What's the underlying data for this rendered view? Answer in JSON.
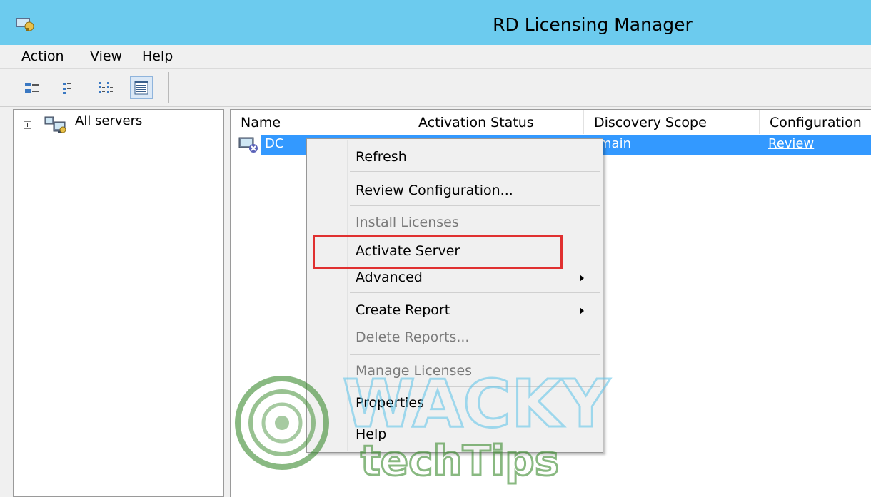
{
  "window": {
    "title": "RD Licensing Manager"
  },
  "menu": {
    "items": [
      "Action",
      "View",
      "Help"
    ]
  },
  "toolbar": {
    "buttons": [
      "large-icons-view-icon",
      "small-icons-view-icon",
      "list-view-icon",
      "details-view-icon"
    ],
    "active": "details-view-icon"
  },
  "tree": {
    "root_label": "All servers"
  },
  "list": {
    "columns": [
      "Name",
      "Activation Status",
      "Discovery Scope",
      "Configuration"
    ],
    "rows": [
      {
        "name": "DC",
        "activation_status": "",
        "discovery_scope": "omain",
        "configuration": "Review",
        "selected": true
      }
    ]
  },
  "context_menu": {
    "items": [
      {
        "label": "Refresh",
        "enabled": true
      },
      {
        "label": "Review Configuration...",
        "enabled": true
      },
      {
        "label": "Install Licenses",
        "enabled": false
      },
      {
        "label": "Activate Server",
        "enabled": true,
        "highlighted": true
      },
      {
        "label": "Advanced",
        "enabled": true,
        "submenu": true
      },
      {
        "label": "Create Report",
        "enabled": true,
        "submenu": true
      },
      {
        "label": "Delete Reports...",
        "enabled": false
      },
      {
        "label": "Manage Licenses",
        "enabled": false
      },
      {
        "label": "Properties",
        "enabled": true
      },
      {
        "label": "Help",
        "enabled": true
      }
    ]
  },
  "watermark": {
    "line1": "WACKY",
    "line2": "techTips"
  },
  "colors": {
    "titlebar": "#6ccbee",
    "selection": "#3399ff",
    "highlight_box": "#e03030",
    "watermark_green": "#3a8a2e",
    "watermark_blue": "#66c6ea"
  }
}
